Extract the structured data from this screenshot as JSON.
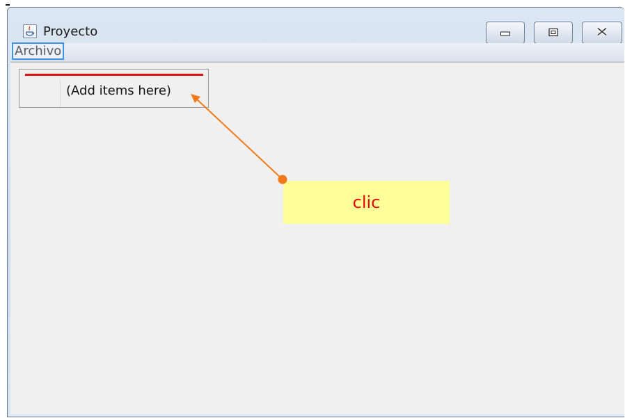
{
  "window": {
    "title": "Proyecto",
    "controls": {
      "minimize_icon": "minimize-icon",
      "maximize_icon": "maximize-icon",
      "close_icon": "close-icon"
    }
  },
  "menubar": {
    "items": [
      {
        "label": "Archivo"
      }
    ]
  },
  "popup_menu": {
    "items": [
      {
        "label": "(Add items here)"
      }
    ]
  },
  "annotation": {
    "callout_text": "clic",
    "callout_color": "#ffff99",
    "callout_text_color": "#e3060a",
    "arrow_color": "#f07a1a",
    "highlight_color": "#3f93e6",
    "underline_color": "#e01010"
  }
}
